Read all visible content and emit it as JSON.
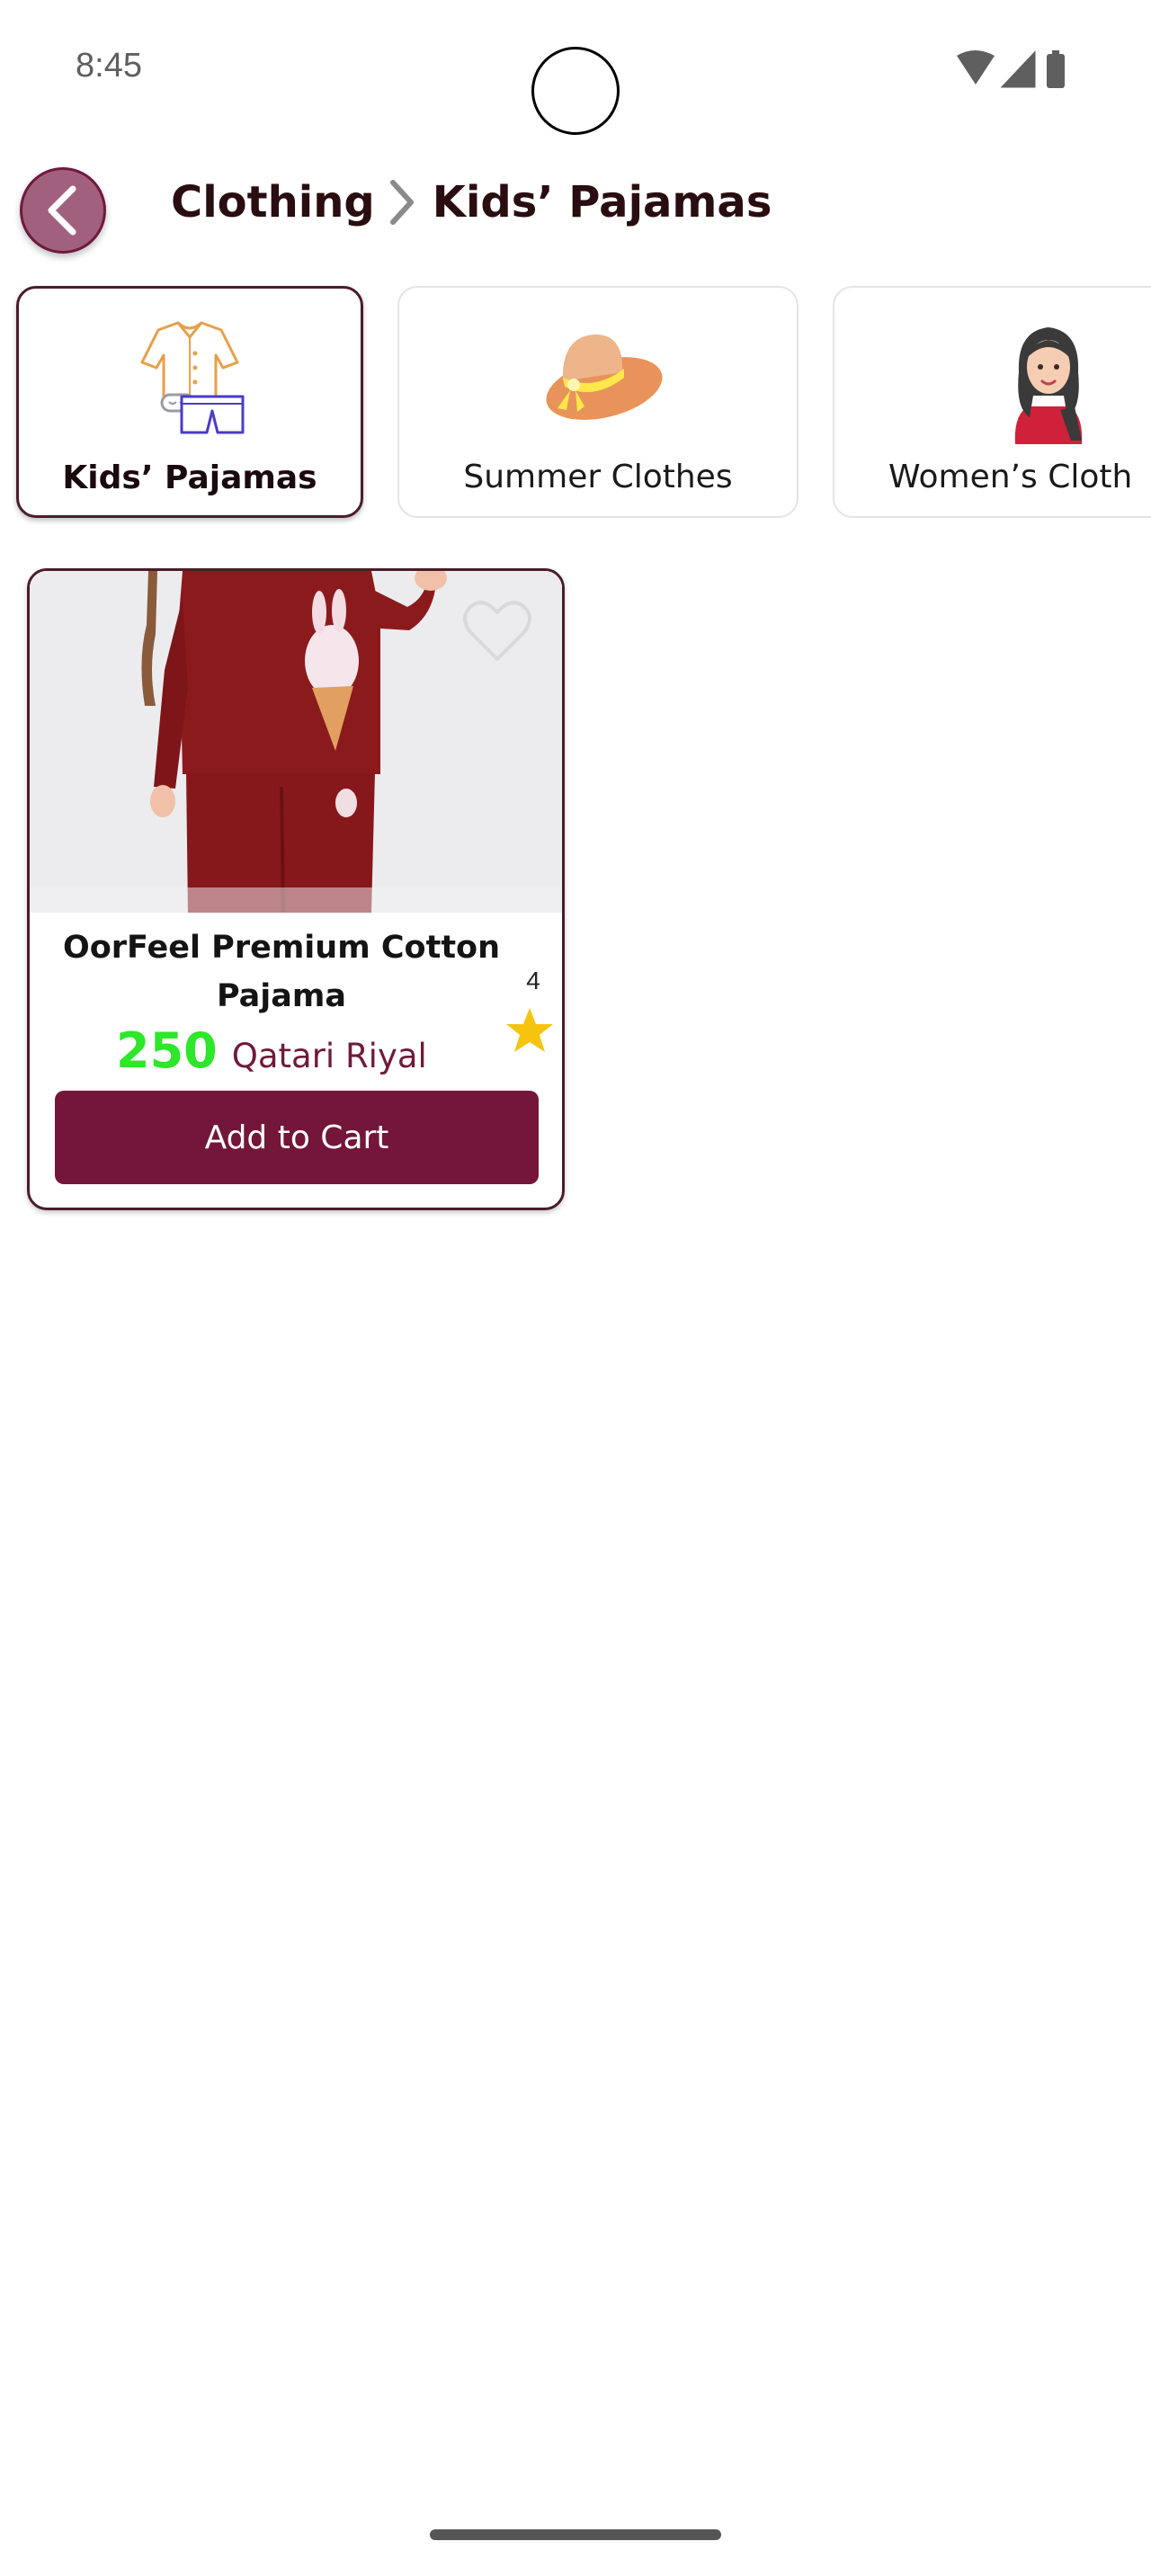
{
  "status_bar": {
    "time": "8:45",
    "icons": [
      "wifi-icon",
      "signal-icon",
      "battery-icon"
    ]
  },
  "header": {
    "back_icon": "chevron-left-icon",
    "breadcrumb": {
      "parent": "Clothing",
      "separator_icon": "chevron-right-icon",
      "current": "Kids’ Pajamas"
    }
  },
  "categories": [
    {
      "label": "Kids’ Pajamas",
      "icon": "pajamas-icon",
      "selected": true
    },
    {
      "label": "Summer Clothes",
      "icon": "sun-hat-icon",
      "selected": false
    },
    {
      "label": "Women’s Cloth",
      "icon": "woman-hijab-icon",
      "selected": false
    }
  ],
  "products": [
    {
      "name": "OorFeel Premium Cotton Pajama",
      "price": "250",
      "currency": "Qatari Riyal",
      "rating": "4",
      "favorite": false,
      "add_to_cart_label": "Add to Cart"
    }
  ],
  "colors": {
    "accent": "#73163a",
    "back_button": "#a2607f",
    "price": "#2ee62a",
    "currency": "#6f1a3c",
    "star": "#f6c311"
  }
}
